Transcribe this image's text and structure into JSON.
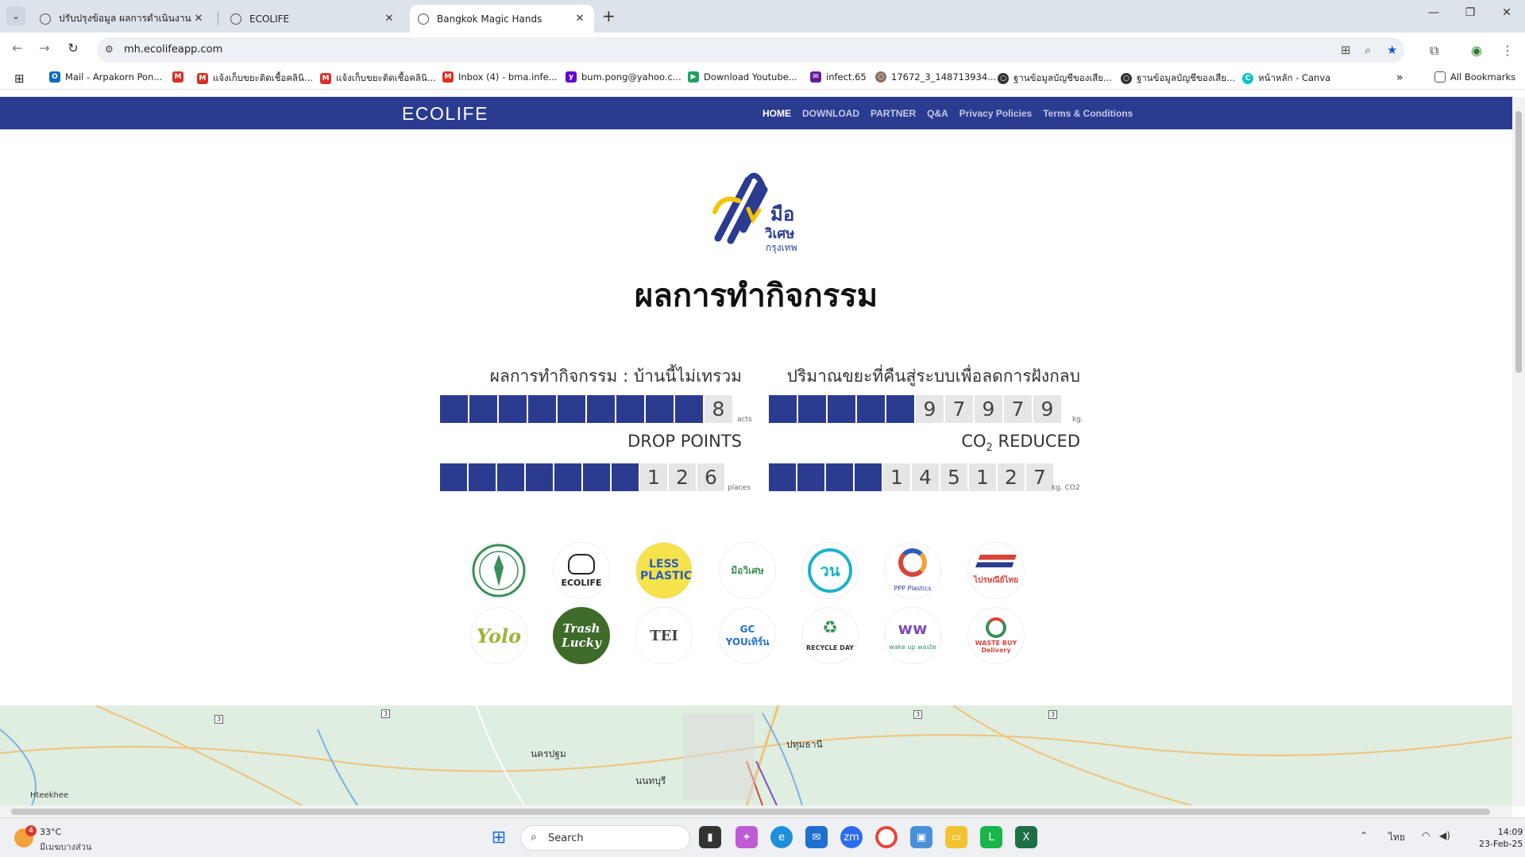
{
  "browser": {
    "tabs": [
      {
        "title": "ปรับปรุงข้อมูล ผลการดำเนินงาน:",
        "active": false
      },
      {
        "title": "ECOLIFE",
        "active": false
      },
      {
        "title": "Bangkok Magic Hands",
        "active": true
      }
    ],
    "url": "mh.ecolifeapp.com",
    "bookmarks": [
      {
        "label": "Mail - Arpakorn Pon...",
        "icon": "outlook-icon",
        "color": "#0f6cbd"
      },
      {
        "label": "แจ้งเก็บขยะติดเชื้อคลินิ...",
        "icon": "gmail-icon",
        "color": "#d93025"
      },
      {
        "label": "แจ้งเก็บขยะติดเชื้อคลินิ...",
        "icon": "gmail-icon",
        "color": "#d93025"
      },
      {
        "label": "Inbox (4) - bma.infe...",
        "icon": "gmail-icon",
        "color": "#d93025"
      },
      {
        "label": "bum.pong@yahoo.c...",
        "icon": "yahoo-icon",
        "color": "#6001d2"
      },
      {
        "label": "Download Youtube...",
        "icon": "play-icon",
        "color": "#1aa260"
      },
      {
        "label": "infect.65",
        "icon": "mail-icon",
        "color": "#6a1b9a"
      },
      {
        "label": "17672_3_148713934...",
        "icon": "globe-icon",
        "color": "#8d6e63"
      },
      {
        "label": "ฐานข้อมูลบัญชีของเสีย...",
        "icon": "globe-icon",
        "color": "#333333"
      },
      {
        "label": "ฐานข้อมูลบัญชีของเสีย...",
        "icon": "globe-icon",
        "color": "#333333"
      },
      {
        "label": "หน้าหลัก - Canva",
        "icon": "canva-icon",
        "color": "#00c4cc"
      }
    ],
    "all_bookmarks": "All Bookmarks"
  },
  "site": {
    "brand": "ECOLIFE",
    "nav": [
      {
        "label": "HOME",
        "active": true
      },
      {
        "label": "DOWNLOAD",
        "active": false
      },
      {
        "label": "PARTNER",
        "active": false
      },
      {
        "label": "Q&A",
        "active": false
      },
      {
        "label": "Privacy Policies",
        "active": false
      },
      {
        "label": "Terms & Conditions",
        "active": false
      }
    ],
    "logo": {
      "line1": "มือ",
      "line2": "วิเศษ",
      "line3": "กรุงเทพ"
    },
    "headline": "ผลการทำกิจกรรม",
    "stats": {
      "activities": {
        "label": "ผลการทำกิจกรรม : บ้านนี้ไม่เทรวม",
        "digits": [
          "8"
        ],
        "unit": "acts"
      },
      "waste": {
        "label": "ปริมาณขยะที่คืนสู่ระบบเพื่อลดการฝังกลบ",
        "digits": [
          "9",
          "7",
          "9",
          "7",
          "9"
        ],
        "unit": "kg."
      },
      "drop_points": {
        "label": "DROP POINTS",
        "digits": [
          "1",
          "2",
          "6"
        ],
        "unit": "places"
      },
      "co2": {
        "label_pre": "CO",
        "label_sub": "2",
        "label_post": " REDUCED",
        "digits": [
          "1",
          "4",
          "5",
          "1",
          "2",
          "7"
        ],
        "unit": "kg. CO2"
      }
    },
    "partners_row1": [
      {
        "name": "bma-seal",
        "text": ""
      },
      {
        "name": "ecolife",
        "text": "ECOLIFE"
      },
      {
        "name": "less-plastic",
        "text": "LESS PLASTIC"
      },
      {
        "name": "magic-hands-foundation",
        "text": "มือวิเศษ"
      },
      {
        "name": "won",
        "text": "วน"
      },
      {
        "name": "ppp-plastics",
        "text": "PPP Plastics"
      },
      {
        "name": "thailand-post",
        "text": "ไปรษณีย์ไทย"
      }
    ],
    "partners_row2": [
      {
        "name": "yolo",
        "text": "Yolo"
      },
      {
        "name": "trash-lucky",
        "text": "Trash Lucky"
      },
      {
        "name": "tei",
        "text": "TEI"
      },
      {
        "name": "gc-youthkrun",
        "text": "GC YOUเทิร์น"
      },
      {
        "name": "recycle-day",
        "text": "RECYCLE DAY"
      },
      {
        "name": "wake-up-waste",
        "text": "wake up waste"
      },
      {
        "name": "wastebuy-delivery",
        "text": "WASTE BUY Delivery"
      }
    ],
    "map_labels": [
      {
        "text": "นครปฐม"
      },
      {
        "text": "ปทุมธานี"
      },
      {
        "text": "นนทบุรี"
      },
      {
        "text": "Hteekhee"
      }
    ]
  },
  "taskbar": {
    "weather_temp": "33°C",
    "weather_desc": "มีเมฆบางส่วน",
    "weather_badge": "4",
    "search_placeholder": "Search",
    "lang": "ไทย",
    "time": "14:09",
    "date": "23-Feb-25"
  }
}
